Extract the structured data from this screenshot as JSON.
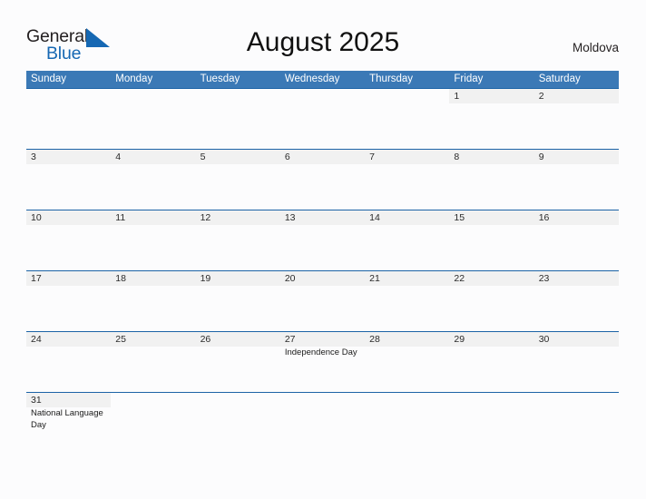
{
  "brand": {
    "name_part1": "General",
    "name_part2": "Blue",
    "mark_icon": "blue-triangle-flag-icon"
  },
  "header": {
    "title": "August 2025",
    "country": "Moldova"
  },
  "colors": {
    "header_blue": "#3B79B6",
    "row_rule_blue": "#1C63A6",
    "band_gray": "#F1F1F1",
    "brand_blue": "#1668B3",
    "page_background": "#FCFCFD"
  },
  "calendar": {
    "month": "August",
    "year": "2025",
    "weekday_headers": [
      "Sunday",
      "Monday",
      "Tuesday",
      "Wednesday",
      "Thursday",
      "Friday",
      "Saturday"
    ],
    "weeks": [
      [
        {
          "num": "",
          "events": []
        },
        {
          "num": "",
          "events": []
        },
        {
          "num": "",
          "events": []
        },
        {
          "num": "",
          "events": []
        },
        {
          "num": "",
          "events": []
        },
        {
          "num": "1",
          "events": []
        },
        {
          "num": "2",
          "events": []
        }
      ],
      [
        {
          "num": "3",
          "events": []
        },
        {
          "num": "4",
          "events": []
        },
        {
          "num": "5",
          "events": []
        },
        {
          "num": "6",
          "events": []
        },
        {
          "num": "7",
          "events": []
        },
        {
          "num": "8",
          "events": []
        },
        {
          "num": "9",
          "events": []
        }
      ],
      [
        {
          "num": "10",
          "events": []
        },
        {
          "num": "11",
          "events": []
        },
        {
          "num": "12",
          "events": []
        },
        {
          "num": "13",
          "events": []
        },
        {
          "num": "14",
          "events": []
        },
        {
          "num": "15",
          "events": []
        },
        {
          "num": "16",
          "events": []
        }
      ],
      [
        {
          "num": "17",
          "events": []
        },
        {
          "num": "18",
          "events": []
        },
        {
          "num": "19",
          "events": []
        },
        {
          "num": "20",
          "events": []
        },
        {
          "num": "21",
          "events": []
        },
        {
          "num": "22",
          "events": []
        },
        {
          "num": "23",
          "events": []
        }
      ],
      [
        {
          "num": "24",
          "events": []
        },
        {
          "num": "25",
          "events": []
        },
        {
          "num": "26",
          "events": []
        },
        {
          "num": "27",
          "events": [
            "Independence Day"
          ]
        },
        {
          "num": "28",
          "events": []
        },
        {
          "num": "29",
          "events": []
        },
        {
          "num": "30",
          "events": []
        }
      ],
      [
        {
          "num": "31",
          "events": [
            "National Language Day"
          ]
        },
        {
          "num": "",
          "events": []
        },
        {
          "num": "",
          "events": []
        },
        {
          "num": "",
          "events": []
        },
        {
          "num": "",
          "events": []
        },
        {
          "num": "",
          "events": []
        },
        {
          "num": "",
          "events": []
        }
      ]
    ],
    "holidays": [
      {
        "date": "27",
        "name": "Independence Day"
      },
      {
        "date": "31",
        "name": "National Language Day"
      }
    ]
  }
}
